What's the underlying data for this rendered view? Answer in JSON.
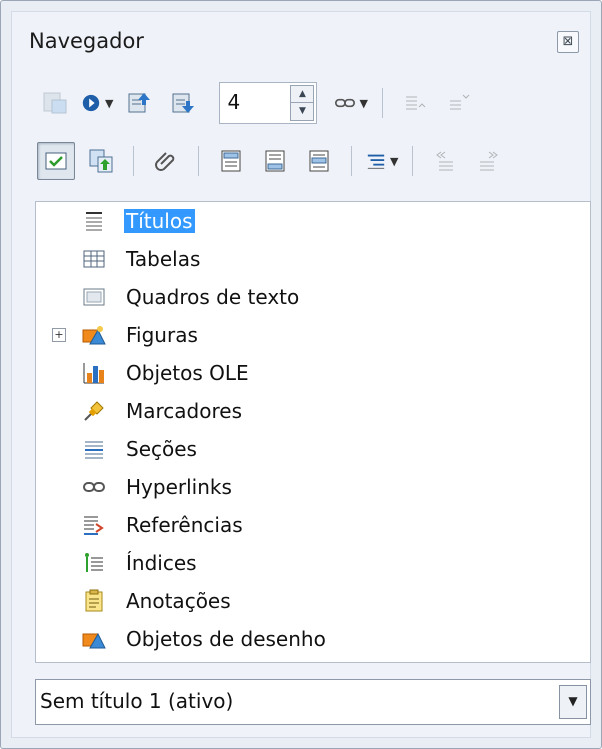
{
  "window": {
    "title": "Navegador",
    "close_glyph": "⊠"
  },
  "toolbar1": {
    "spin_value": "4"
  },
  "tree": {
    "items": [
      {
        "label": "Títulos",
        "icon": "headings-icon",
        "selected": true
      },
      {
        "label": "Tabelas",
        "icon": "table-icon"
      },
      {
        "label": "Quadros de texto",
        "icon": "text-frame-icon"
      },
      {
        "label": "Figuras",
        "icon": "image-icon",
        "expandable": true
      },
      {
        "label": "Objetos OLE",
        "icon": "ole-object-icon"
      },
      {
        "label": "Marcadores",
        "icon": "bookmark-pin-icon"
      },
      {
        "label": "Seções",
        "icon": "section-icon"
      },
      {
        "label": "Hyperlinks",
        "icon": "hyperlink-icon"
      },
      {
        "label": "Referências",
        "icon": "reference-icon"
      },
      {
        "label": "Índices",
        "icon": "index-icon"
      },
      {
        "label": "Anotações",
        "icon": "annotation-icon"
      },
      {
        "label": "Objetos de desenho",
        "icon": "drawing-object-icon"
      }
    ]
  },
  "document_select": {
    "value": "Sem título 1 (ativo)"
  },
  "colors": {
    "selection": "#3399ff",
    "panel_bg": "#eff3f9"
  }
}
